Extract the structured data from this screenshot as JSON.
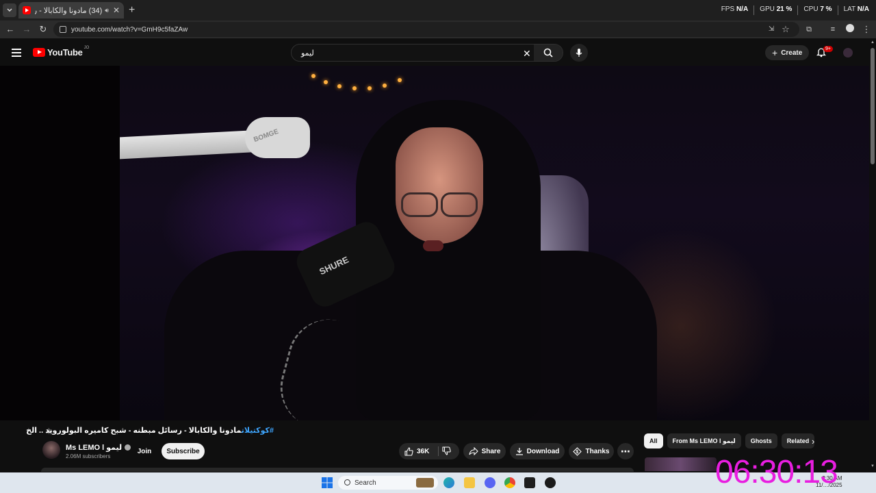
{
  "browser": {
    "tab_title": "(34) مادونا والكابالا - رسائل ...",
    "new_tab_symbol": "+",
    "url": "youtube.com/watch?v=GmH9c5faZAw",
    "hud": [
      {
        "label": "FPS",
        "value": "N/A"
      },
      {
        "label": "GPU",
        "value": "21 %"
      },
      {
        "label": "CPU",
        "value": "7 %"
      },
      {
        "label": "LAT",
        "value": "N/A"
      }
    ]
  },
  "youtube": {
    "logo_text": "YouTube",
    "country_code": "JO",
    "search_query": "ليمو",
    "create_label": "Create",
    "notification_count": "9+"
  },
  "video": {
    "title_hashtag": "#كوكتيلات",
    "title_rest": "مادونا والكابالا - رسائل مبطنه - شبح كاميره البولورويد .. الخ",
    "mic_brand": "SHURE",
    "mount_brand": "BOMGE",
    "channel_name": "Ms LEMO l ليمو",
    "subscribers": "2.06M subscribers",
    "join_label": "Join",
    "subscribe_label": "Subscribe",
    "like_count": "36K",
    "share_label": "Share",
    "download_label": "Download",
    "thanks_label": "Thanks"
  },
  "chips": [
    "All",
    "From Ms LEMO l ليمو",
    "Ghosts",
    "Related"
  ],
  "taskbar": {
    "search_label": "Search",
    "tray_time": "2:30 AM",
    "tray_date": "11/…/2025"
  },
  "overlay_clock": "06:30:13",
  "colors": {
    "youtube_red": "#ff0000",
    "link_blue": "#3ea6ff",
    "clock_magenta": "#e81ee0"
  }
}
